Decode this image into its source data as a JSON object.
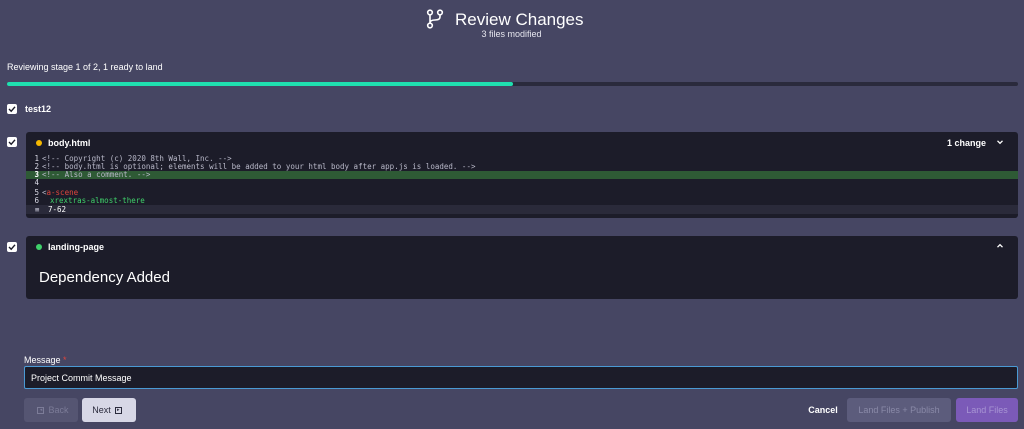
{
  "header": {
    "title": "Review Changes",
    "subtitle": "3 files modified",
    "icon": "git-branch-icon"
  },
  "progress": {
    "status_text": "Reviewing stage 1 of 2, 1 ready to land",
    "fraction": 0.5,
    "fill_color": "#1fe0b0"
  },
  "group": {
    "label": "test12",
    "checked": true
  },
  "files": [
    {
      "name": "body.html",
      "status_color": "#f5b800",
      "checked": true,
      "change_count": "1 change",
      "expand_icon": "chevron-down-icon",
      "code": [
        {
          "num": "1",
          "text": "<!-- Copyright (c) 2020 8th Wall, Inc. -->",
          "added": false
        },
        {
          "num": "2",
          "text": "<!-- body.html is optional; elements will be added to your html body after app.js is loaded. -->",
          "added": false
        },
        {
          "num": "3",
          "text": "<!-- Also a comment. -->",
          "added": true
        },
        {
          "num": "4",
          "text": "",
          "added": false
        },
        {
          "num": "5",
          "tag_open": "<",
          "tag_name": "a-scene",
          "added": false
        },
        {
          "num": "6",
          "attr": "xrextras-almost-there",
          "added": false
        }
      ],
      "fold": {
        "icon": "fold-lines-icon",
        "range": "7-62"
      }
    },
    {
      "name": "landing-page",
      "status_color": "#3fd16a",
      "checked": true,
      "expand_icon": "chevron-up-icon",
      "body_title": "Dependency Added"
    }
  ],
  "message": {
    "label": "Message",
    "required_mark": "*",
    "value": "Project Commit Message"
  },
  "footer": {
    "back_label": "Back",
    "next_label": "Next",
    "cancel_label": "Cancel",
    "land_publish_label": "Land Files + Publish",
    "land_label": "Land Files"
  },
  "colors": {
    "background": "#464663",
    "panel": "#1c1c29",
    "accent_purple": "#7b5ab8",
    "added_line": "#2e5a35"
  }
}
